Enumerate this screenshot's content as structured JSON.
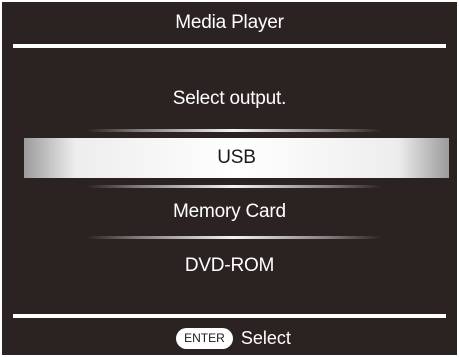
{
  "header": {
    "title": "Media Player"
  },
  "dialog": {
    "prompt": "Select output.",
    "options": [
      {
        "label": "USB",
        "selected": true
      },
      {
        "label": "Memory Card",
        "selected": false
      },
      {
        "label": "DVD-ROM",
        "selected": false
      }
    ]
  },
  "footer": {
    "key_label": "ENTER",
    "action_label": "Select"
  },
  "colors": {
    "background": "#2b2321",
    "text": "#ffffff",
    "selected_text": "#1a1a1a",
    "highlight": "#ffffff"
  }
}
